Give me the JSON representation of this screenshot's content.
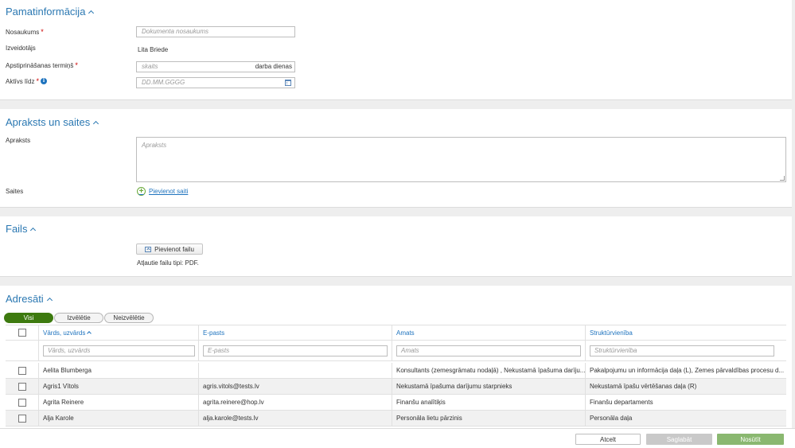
{
  "basic": {
    "title": "Pamatinformācija",
    "name_label": "Nosaukums",
    "name_placeholder": "Dokumenta nosaukums",
    "creator_label": "Izveidotājs",
    "creator_value": "Lita Briede",
    "deadline_label": "Apstiprināšanas termiņš",
    "deadline_placeholder": "skaits",
    "deadline_suffix": "darba dienas",
    "active_label": "Aktīvs līdz",
    "active_placeholder": "DD.MM.GGGG",
    "required_mark": "*"
  },
  "description": {
    "title": "Apraksts un saites",
    "desc_label": "Apraksts",
    "desc_placeholder": "Apraksts",
    "links_label": "Saites",
    "add_link_label": "Pievienot saiti"
  },
  "files": {
    "title": "Fails",
    "add_file_label": "Pievienot failu",
    "allowed_types": "Atļautie failu tipi: PDF."
  },
  "recipients": {
    "title": "Adresāti",
    "filters": [
      "Visi",
      "Izvēlētie",
      "Neizvēlētie"
    ],
    "columns": [
      "Vārds, uzvārds",
      "E-pasts",
      "Amats",
      "Struktūrvienība"
    ],
    "filter_placeholders": [
      "Vārds, uzvārds",
      "E-pasts",
      "Amats",
      "Struktūrvienība"
    ],
    "rows": [
      [
        "Aelita Blumberga",
        "",
        "Konsultants (zemesgrāmatu nodaļā) , Nekustamā īpašuma darīju...",
        "Pakalpojumu un informācija daļa (L), Zemes pārvaldības procesu d..."
      ],
      [
        "Agris1 Vītols",
        "agris.vitols@tests.lv",
        "Nekustamā īpašuma darījumu starpnieks",
        "Nekustamā īpašu vērtēšanas daļa (R)"
      ],
      [
        "Agrita Reinere",
        "agrita.reinere@hop.lv",
        "Finanšu analītiķis",
        "Finanšu departaments"
      ],
      [
        "Alja Karole",
        "alja.karole@tests.lv",
        "Personāla lietu pārzinis",
        "Personāla daļa"
      ]
    ]
  },
  "footer": {
    "cancel": "Atcelt",
    "save": "Saglabāt",
    "send": "Nosūtīt"
  },
  "colors": {
    "accent": "#2b78b2",
    "primary_green": "#3d7a0f",
    "send_green": "#8ab870"
  }
}
